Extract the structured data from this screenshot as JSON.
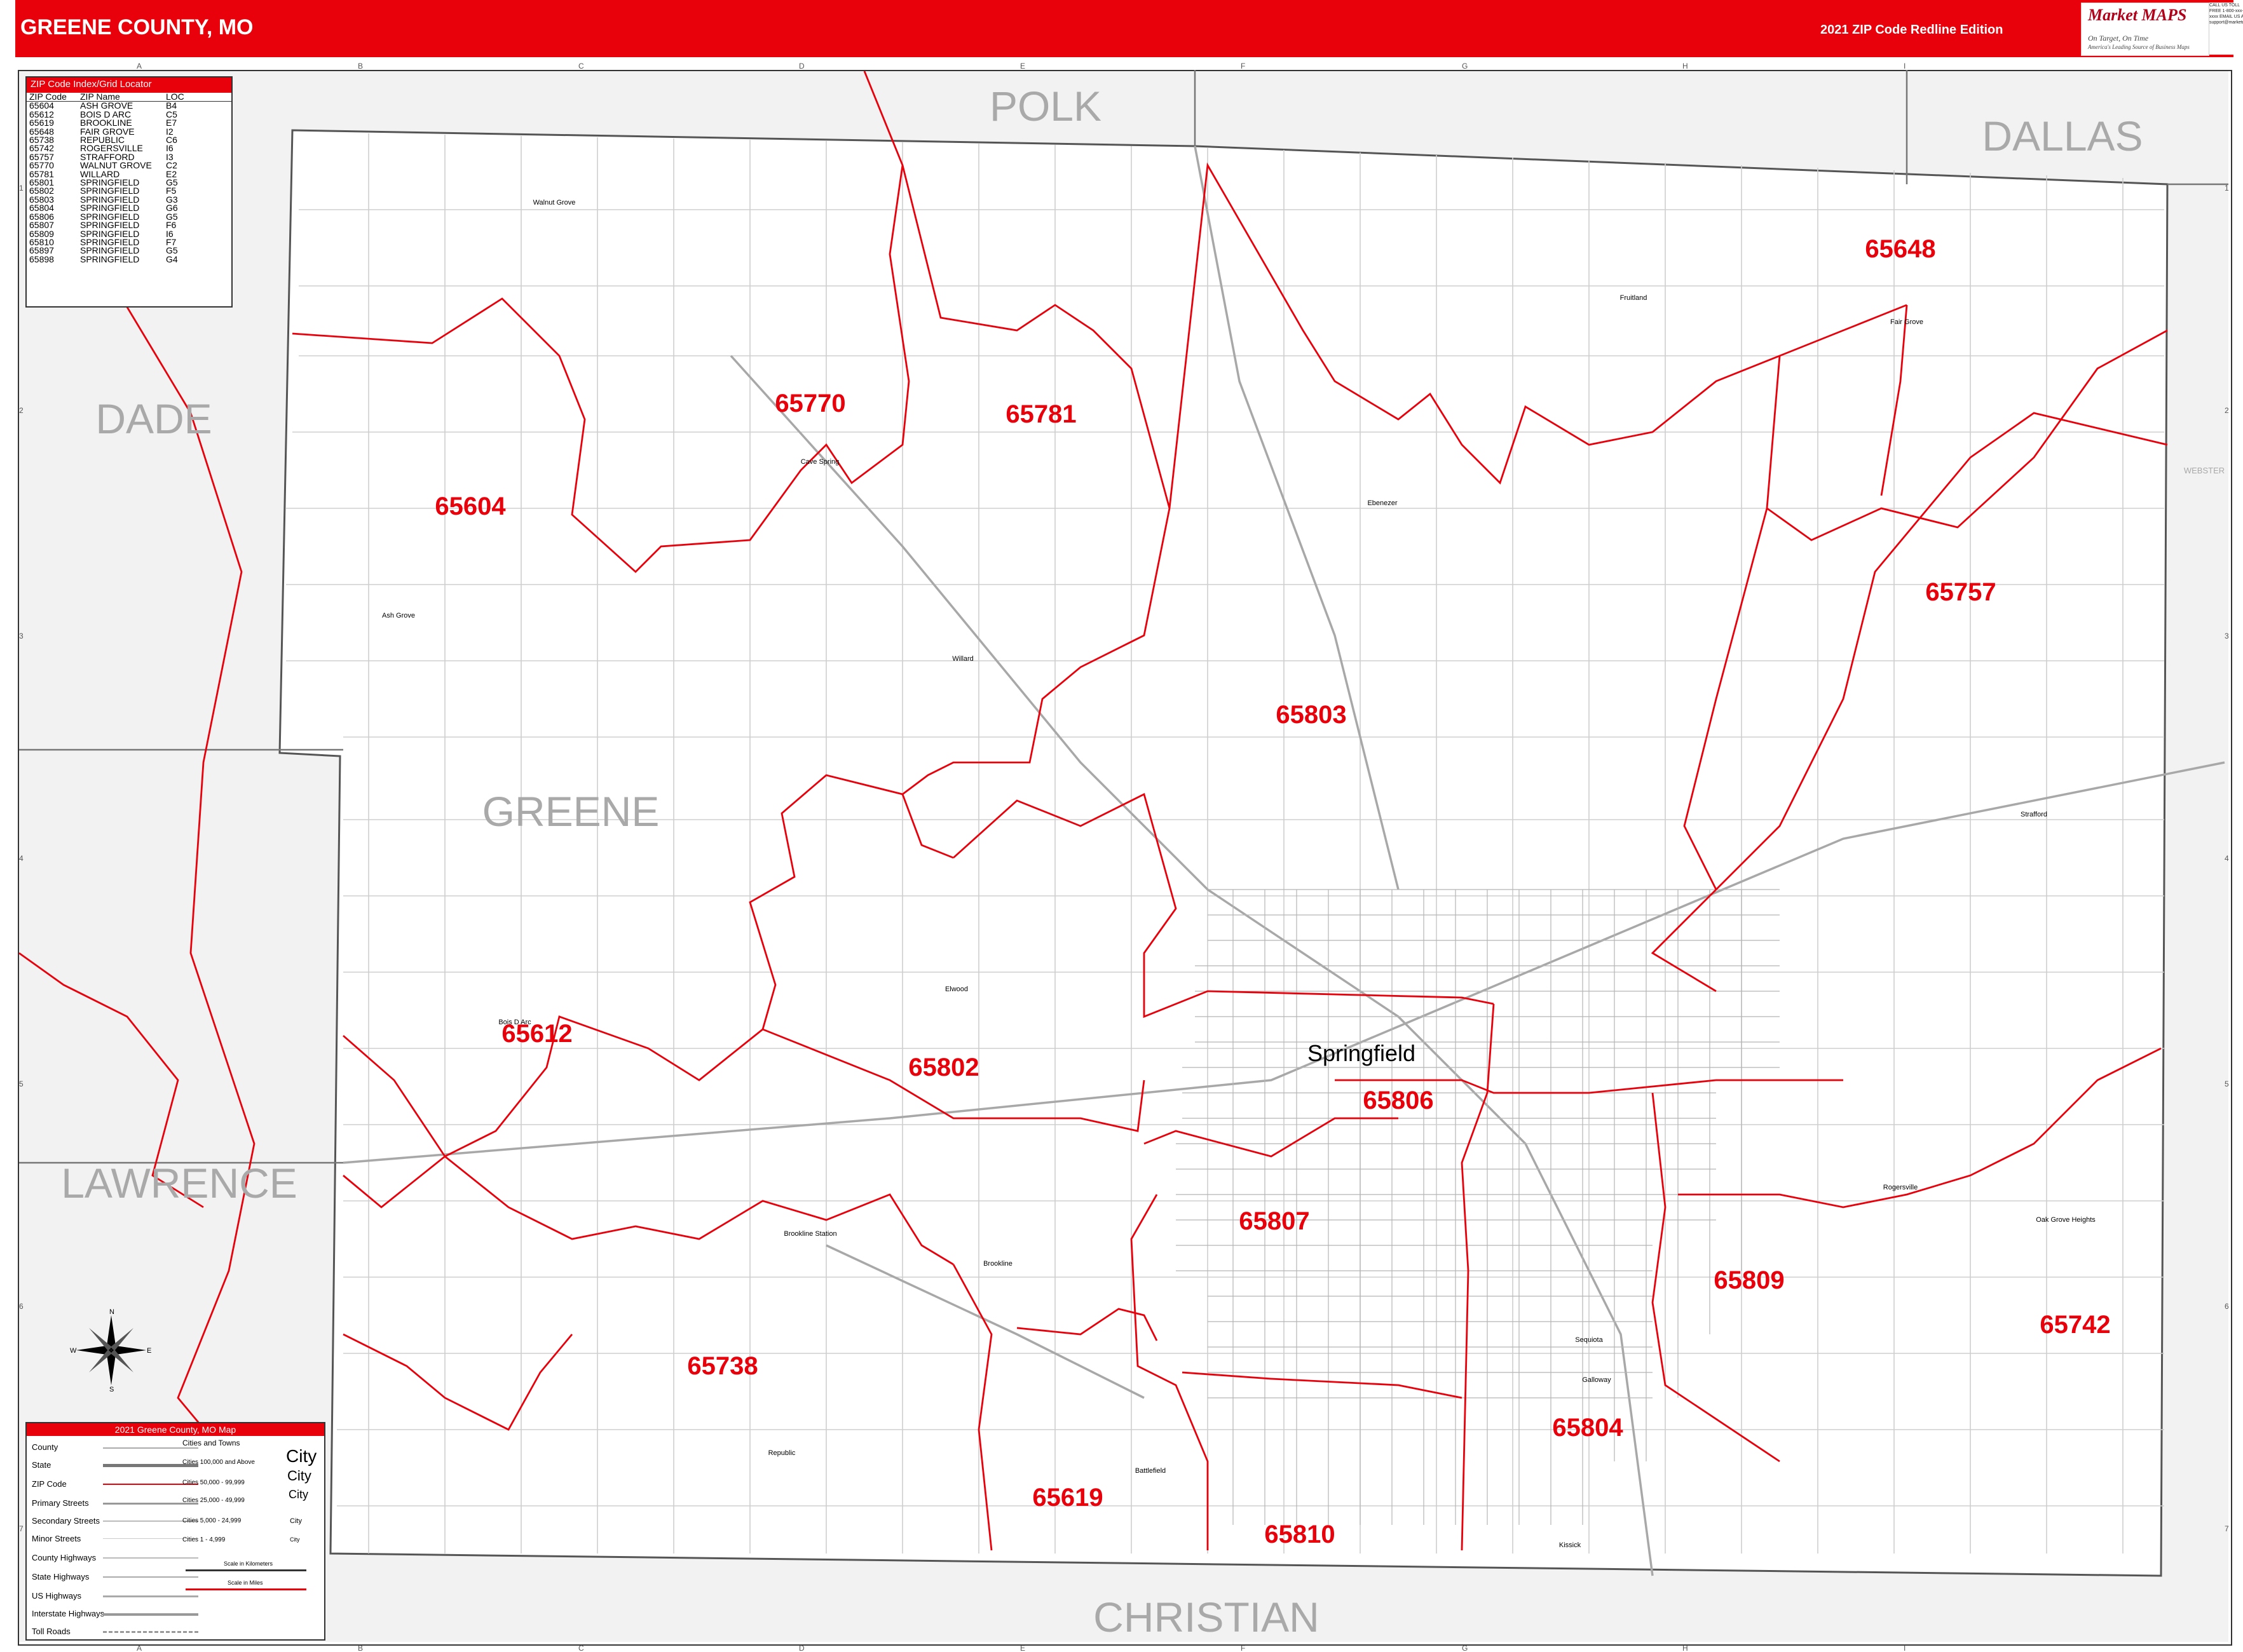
{
  "header": {
    "title": "GREENE COUNTY, MO",
    "edition": "2021 ZIP Code Redline Edition",
    "logo_brand": "Market MAPS",
    "logo_tagline": "On Target, On Time",
    "logo_subtagline": "America's Leading Source of Business Maps",
    "contact_text": "CALL US TOLL FREE 1-800-xxx-xxxx EMAIL US AT support@marketmaps.com"
  },
  "grid": {
    "columns": [
      "A",
      "B",
      "C",
      "D",
      "E",
      "F",
      "G",
      "H",
      "I"
    ],
    "rows": [
      "1",
      "2",
      "3",
      "4",
      "5",
      "6",
      "7"
    ]
  },
  "county_labels": [
    {
      "name": "POLK"
    },
    {
      "name": "DALLAS"
    },
    {
      "name": "DADE"
    },
    {
      "name": "GREENE"
    },
    {
      "name": "LAWRENCE"
    },
    {
      "name": "CHRISTIAN"
    },
    {
      "name": "WEBSTER"
    }
  ],
  "zip_labels": [
    "65648",
    "65770",
    "65781",
    "65604",
    "65757",
    "65803",
    "65612",
    "65802",
    "65806",
    "65807",
    "65809",
    "65742",
    "65738",
    "65804",
    "65619",
    "65810"
  ],
  "places": [
    "Springfield",
    "Walnut Grove",
    "Cave Spring",
    "Ash Grove",
    "Willard",
    "Ebenezer",
    "Fruitland",
    "Fair Grove",
    "Strafford",
    "Bois D Arc",
    "Elwood",
    "Brookline",
    "Brookline Station",
    "Republic",
    "Battlefield",
    "Sequiota",
    "Galloway",
    "Kissick",
    "Oak Grove Heights",
    "Rogersville"
  ],
  "zip_index": {
    "title": "ZIP Code Index/Grid Locator",
    "columns": [
      "ZIP Code",
      "ZIP Name",
      "LOC"
    ],
    "rows": [
      [
        "65604",
        "ASH GROVE",
        "B4"
      ],
      [
        "65612",
        "BOIS D ARC",
        "C5"
      ],
      [
        "65619",
        "BROOKLINE",
        "E7"
      ],
      [
        "65648",
        "FAIR GROVE",
        "I2"
      ],
      [
        "65738",
        "REPUBLIC",
        "C6"
      ],
      [
        "65742",
        "ROGERSVILLE",
        "I6"
      ],
      [
        "65757",
        "STRAFFORD",
        "I3"
      ],
      [
        "65770",
        "WALNUT GROVE",
        "C2"
      ],
      [
        "65781",
        "WILLARD",
        "E2"
      ],
      [
        "65801",
        "SPRINGFIELD",
        "G5"
      ],
      [
        "65802",
        "SPRINGFIELD",
        "F5"
      ],
      [
        "65803",
        "SPRINGFIELD",
        "G3"
      ],
      [
        "65804",
        "SPRINGFIELD",
        "G6"
      ],
      [
        "65806",
        "SPRINGFIELD",
        "G5"
      ],
      [
        "65807",
        "SPRINGFIELD",
        "F6"
      ],
      [
        "65809",
        "SPRINGFIELD",
        "I6"
      ],
      [
        "65810",
        "SPRINGFIELD",
        "F7"
      ],
      [
        "65897",
        "SPRINGFIELD",
        "G5"
      ],
      [
        "65898",
        "SPRINGFIELD",
        "G4"
      ]
    ]
  },
  "legend": {
    "title": "2021 Greene County, MO Map",
    "items": [
      "County",
      "State",
      "ZIP Code",
      "Primary Streets",
      "Secondary Streets",
      "Minor Streets",
      "County Highways",
      "State Highways",
      "US Highways",
      "Interstate Highways",
      "Toll Roads"
    ],
    "cities_title": "Cities and Towns",
    "cities": [
      "Cities 100,000 and Above",
      "Cities 50,000 - 99,999",
      "Cities 25,000 - 49,999",
      "Cities 5,000 - 24,999",
      "Cities 1 - 4,999"
    ],
    "city_samples": [
      "City",
      "City",
      "City",
      "City",
      "City"
    ],
    "scale_km": "Scale in Kilometers",
    "scale_mi": "Scale in Miles"
  },
  "compass": {
    "n": "N",
    "s": "S",
    "e": "E",
    "w": "W"
  },
  "colors": {
    "header": "#e8000b",
    "zip_boundary": "#e8000b",
    "county_label": "#a9a9a9",
    "roads": "#c8c8c8"
  }
}
